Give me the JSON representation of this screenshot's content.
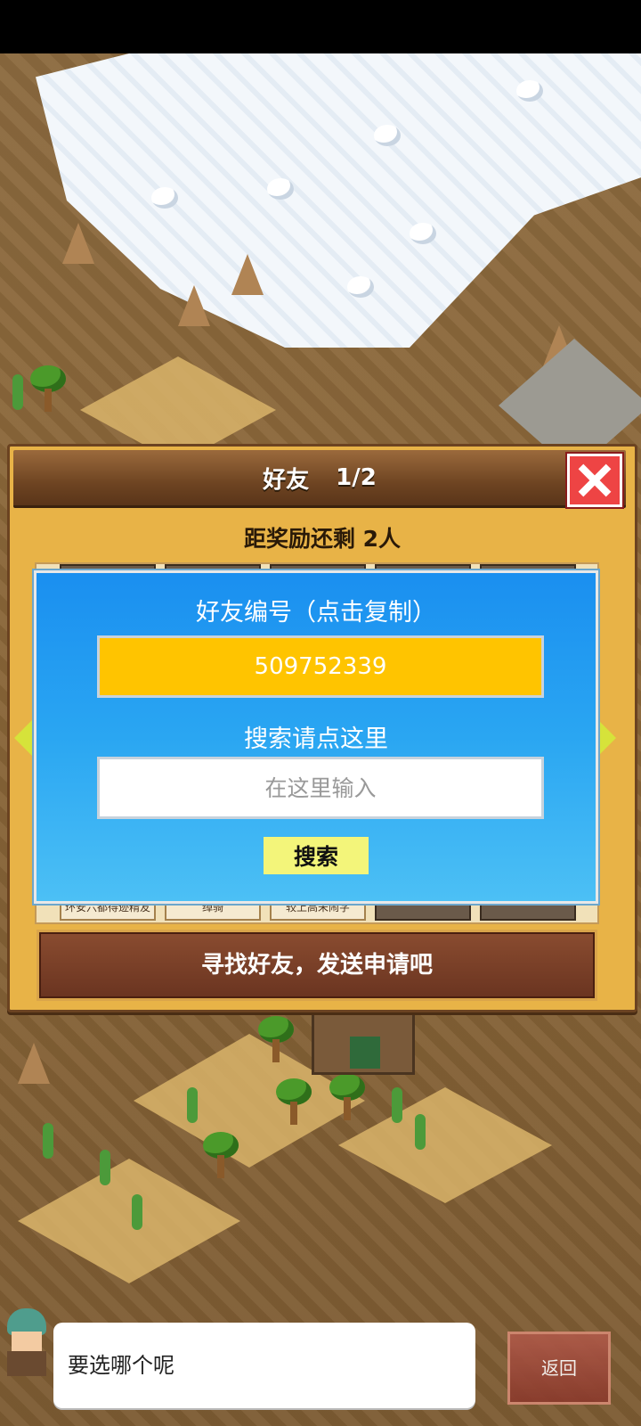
{
  "panel": {
    "title": "好友",
    "page": "1/2",
    "reward_text": "距奖励还剩 2人",
    "friend_labels": [
      "环安六都得迹精友",
      "绰骑",
      "较上高未闹字"
    ],
    "send_request_label": "寻找好友，发送申请吧"
  },
  "dialog": {
    "friend_id_title": "好友编号（点击复制）",
    "friend_id": "509752339",
    "search_title": "搜索请点这里",
    "search_placeholder": "在这里输入",
    "search_button": "搜索"
  },
  "bottom": {
    "speech": "要选哪个呢",
    "back_button": "返回"
  },
  "colors": {
    "id_box": "#ffc400",
    "dialog_blue": "#1a8ff0",
    "search_button": "#f3f57a",
    "close_button": "#e44444"
  },
  "icons": {
    "close": "close-x-icon",
    "prev": "arrow-left-icon",
    "next": "arrow-right-icon"
  }
}
